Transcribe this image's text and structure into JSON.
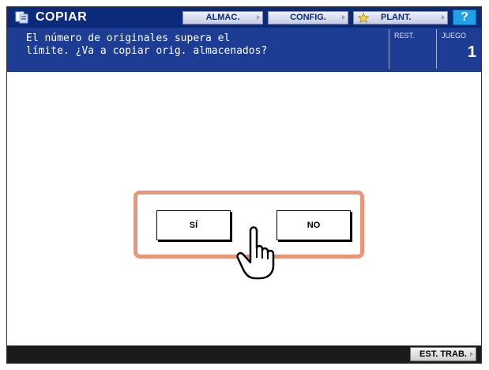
{
  "app": {
    "title": "COPIAR",
    "icon": "copier-icon"
  },
  "toolbar": {
    "almac_label": "ALMAC.",
    "config_label": "CONFIG.",
    "plant_label": "PLANT.",
    "help_label": "?"
  },
  "message": {
    "text": "El número de originales supera el\nlímite. ¿Va a copiar orig. almacenados?",
    "rest_label": "REST.",
    "juego_label": "JUEGO",
    "juego_value": "1"
  },
  "dialog": {
    "yes_label": "SÍ",
    "no_label": "NO"
  },
  "footer": {
    "est_trab_label": "EST. TRAB."
  },
  "colors": {
    "topbar": "#0b2a7a",
    "message_bar": "#1c3d93",
    "dialog_border": "#e8957a",
    "help_button": "#1fa0e8"
  }
}
